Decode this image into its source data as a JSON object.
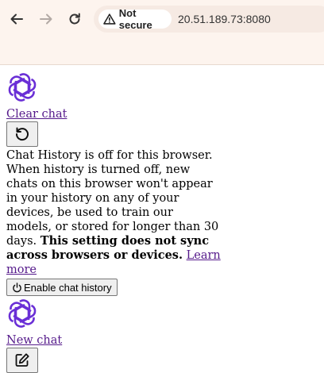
{
  "browser": {
    "security_label": "Not secure",
    "url": "20.51.189.73:8080"
  },
  "sidebar": {
    "clear_chat_label": "Clear chat",
    "history_notice": "Chat History is off for this browser. When history is turned off, new chats on this browser won't appear in your history on any of your devices, be used to train our models, or stored for longer than 30 days.",
    "history_notice_bold": "This setting does not sync across browsers or devices.",
    "learn_more_label": "Learn more",
    "enable_history_label": "Enable chat history",
    "new_chat_label": "New chat"
  },
  "colors": {
    "logo": "#6a2fd6",
    "link": "#551a8b",
    "chrome_bg": "#fdf4ee"
  }
}
